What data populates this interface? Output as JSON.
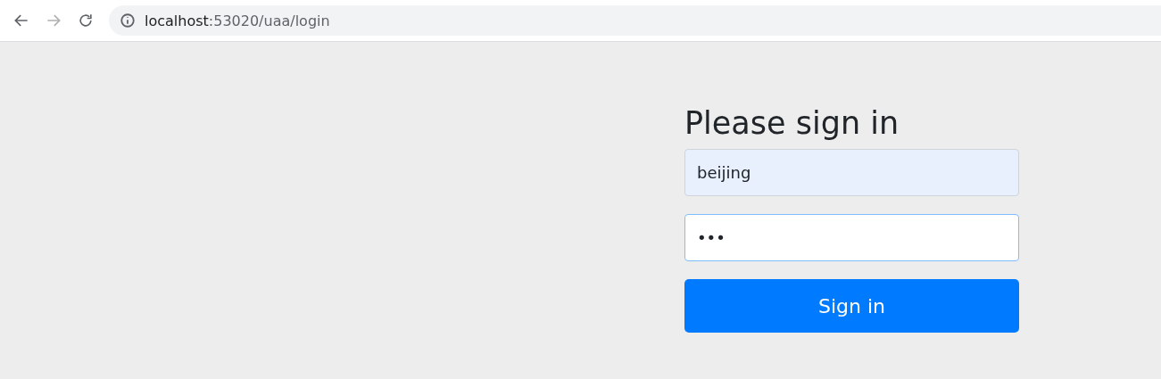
{
  "toolbar": {
    "back": {
      "disabled": false
    },
    "forward": {
      "disabled": true
    },
    "address": {
      "host": "localhost",
      "path": ":53020/uaa/login"
    }
  },
  "form": {
    "heading": "Please sign in",
    "username": {
      "value": "beijing",
      "autofilled": true,
      "focused": false
    },
    "password": {
      "value": "•••",
      "autofilled": false,
      "focused": true
    },
    "submit": "Sign in"
  }
}
